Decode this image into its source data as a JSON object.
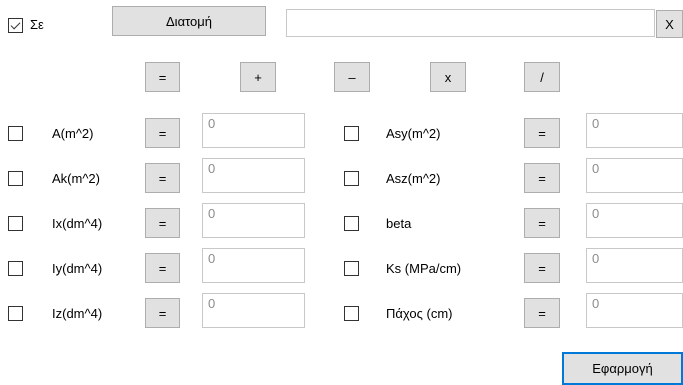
{
  "header": {
    "sigma_label": "Σε",
    "sigma_checked": true,
    "section_button": "Διατομή",
    "section_value": "",
    "clear_button": "X"
  },
  "operators": [
    "=",
    "+",
    "–",
    "x",
    "/"
  ],
  "left_rows": [
    {
      "label": "A(m^2)",
      "op": "=",
      "value": "0"
    },
    {
      "label": "Ak(m^2)",
      "op": "=",
      "value": "0"
    },
    {
      "label": "Ix(dm^4)",
      "op": "=",
      "value": "0"
    },
    {
      "label": "Iy(dm^4)",
      "op": "=",
      "value": "0"
    },
    {
      "label": "Iz(dm^4)",
      "op": "=",
      "value": "0"
    }
  ],
  "right_rows": [
    {
      "label": "Asy(m^2)",
      "op": "=",
      "value": "0"
    },
    {
      "label": "Asz(m^2)",
      "op": "=",
      "value": "0"
    },
    {
      "label": "beta",
      "op": "=",
      "value": "0"
    },
    {
      "label": "Ks (MPa/cm)",
      "op": "=",
      "value": "0"
    },
    {
      "label": "Πάχος (cm)",
      "op": "=",
      "value": "0"
    }
  ],
  "apply_button": "Εφαρμογή",
  "colors": {
    "button_bg": "#e1e1e1",
    "focus_border": "#0078d7",
    "field_text": "#8c8c8c"
  }
}
